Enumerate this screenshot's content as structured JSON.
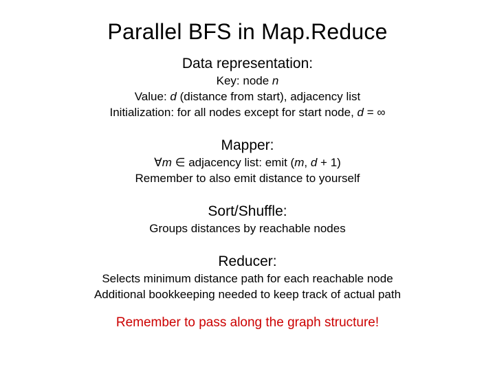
{
  "title": "Parallel BFS in Map.Reduce",
  "sections": {
    "datarep": {
      "heading": "Data representation:",
      "line1_a": "Key: node ",
      "line1_b": "n",
      "line2_a": "Value: ",
      "line2_b": "d",
      "line2_c": " (distance from start), adjacency list",
      "line3_a": "Initialization: for all nodes except for start node, ",
      "line3_b": "d",
      "line3_c": " = ",
      "line3_d": "∞"
    },
    "mapper": {
      "heading": "Mapper:",
      "line1_a": "∀",
      "line1_b": "m",
      "line1_c": " ∈ adjacency list: emit (",
      "line1_d": "m",
      "line1_e": ", ",
      "line1_f": "d",
      "line1_g": " + 1)",
      "line2": "Remember to also emit distance to yourself"
    },
    "shuffle": {
      "heading": "Sort/Shuffle:",
      "line1": "Groups distances by reachable nodes"
    },
    "reducer": {
      "heading": "Reducer:",
      "line1": "Selects minimum distance path for each reachable node",
      "line2": "Additional bookkeeping needed to keep track of actual path"
    }
  },
  "footer": "Remember to pass along the graph structure!"
}
